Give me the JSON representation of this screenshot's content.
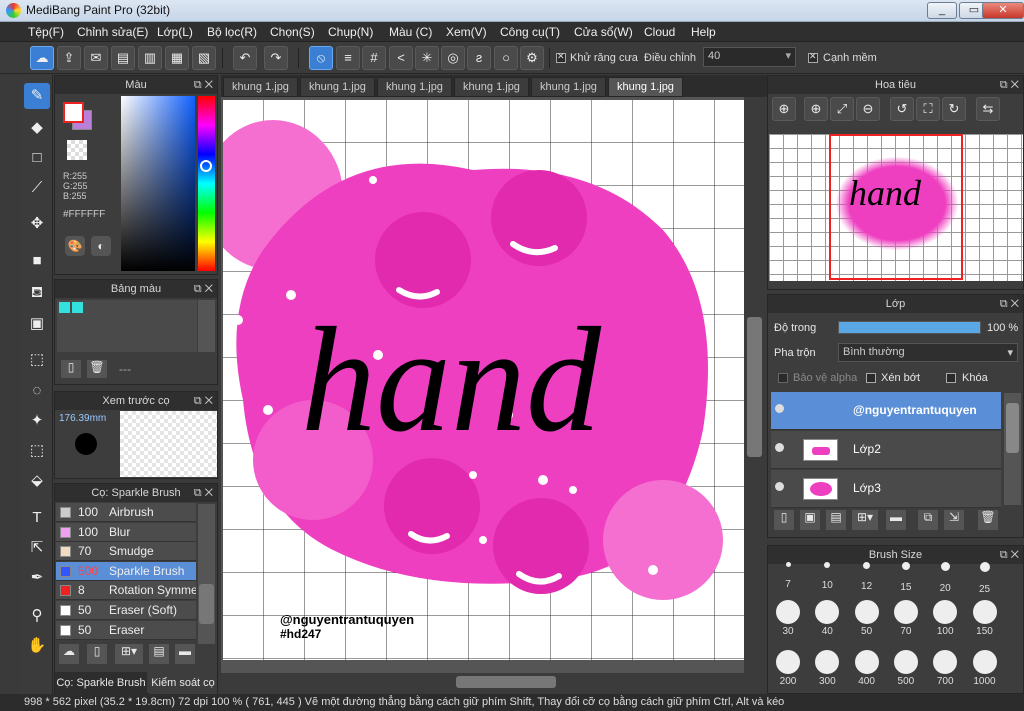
{
  "window": {
    "title": "MediBang Paint Pro (32bit)",
    "min": "_",
    "max": "▭",
    "close": "✕"
  },
  "menu": [
    "Tệp(F)",
    "Chỉnh sửa(E)",
    "Lớp(L)",
    "Bộ lọc(R)",
    "Chọn(S)",
    "Chụp(N)",
    "Màu (C)",
    "Xem(V)",
    "Công cụ(T)",
    "Cửa sổ(W)",
    "Cloud",
    "Help"
  ],
  "toolbar": {
    "antialias_label": "Khử răng cưa",
    "adjust_label": "Điều chỉnh",
    "adjust_value": "40",
    "smooth_label": "Cạnh mềm"
  },
  "color_panel": {
    "title": "Màu",
    "r": "R:255",
    "g": "G:255",
    "b": "B:255",
    "hex": "#FFFFFF",
    "primary_color": "#ffffff",
    "secondary_color": "#b97fd9"
  },
  "palette_panel": {
    "title": "Bảng màu",
    "swatch_color": "#33e0e0",
    "dash": "---"
  },
  "brush_preview": {
    "title": "Xem trước cọ",
    "size": "176.39mm"
  },
  "brush_panel": {
    "title": "Cọ: Sparkle Brush",
    "tab1": "Cọ: Sparkle Brush",
    "tab2": "Kiểm soát cọ",
    "items": [
      {
        "size": "100",
        "name": "Airbrush",
        "color": "#cccccc"
      },
      {
        "size": "100",
        "name": "Blur",
        "color": "#f0a0f0"
      },
      {
        "size": "70",
        "name": "Smudge",
        "color": "#f0dcc0"
      },
      {
        "size": "500",
        "name": "Sparkle Brush",
        "color": "#3355ff"
      },
      {
        "size": "8",
        "name": "Rotation Symmetry",
        "color": "#ee2222"
      },
      {
        "size": "50",
        "name": "Eraser (Soft)",
        "color": "#ffffff"
      },
      {
        "size": "50",
        "name": "Eraser",
        "color": "#ffffff"
      }
    ]
  },
  "tabs": [
    "khung 1.jpg",
    "khung 1.jpg",
    "khung 1.jpg",
    "khung 1.jpg",
    "khung 1.jpg",
    "khung 1.jpg"
  ],
  "artwork": {
    "word": "hand",
    "credit_line1": "@nguyentrantuquyen",
    "credit_line2": "#hd247"
  },
  "navigator": {
    "title": "Hoa tiêu"
  },
  "layer_panel": {
    "title": "Lớp",
    "opacity_label": "Độ trong",
    "opacity_value": "100 %",
    "opacity": 1.0,
    "blend_label": "Pha trộn",
    "blend_value": "Bình thường",
    "protect_alpha": "Bảo vệ alpha",
    "clip": "Xén bớt",
    "lock": "Khóa",
    "layers": [
      {
        "name": "@nguyentrantuquyen"
      },
      {
        "name": "Lớp2"
      },
      {
        "name": "Lớp3"
      }
    ]
  },
  "brush_size": {
    "title": "Brush Size",
    "sizes": [
      "7",
      "10",
      "12",
      "15",
      "20",
      "25",
      "30",
      "40",
      "50",
      "70",
      "100",
      "150",
      "200",
      "300",
      "400",
      "500",
      "700",
      "1000"
    ]
  },
  "status": "998 * 562 pixel   (35.2 * 19.8cm)   72 dpi   100 %   ( 761, 445 )   Vẽ một đường thẳng bằng cách giữ phím Shift, Thay đổi cỡ cọ bằng cách giữ phím Ctrl, Alt và kéo"
}
